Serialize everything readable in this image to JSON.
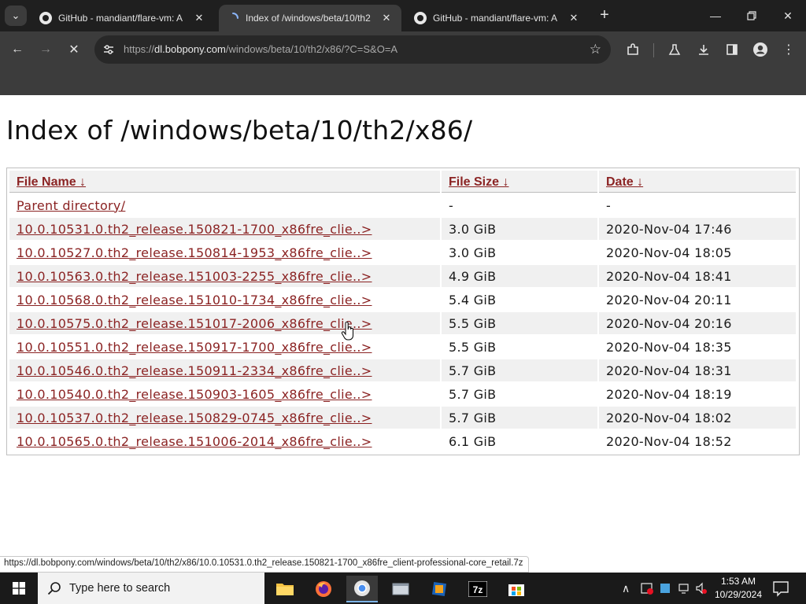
{
  "browser": {
    "tabs": [
      {
        "title": "GitHub - mandiant/flare-vm: A",
        "active": false
      },
      {
        "title": "Index of /windows/beta/10/th2",
        "active": true
      },
      {
        "title": "GitHub - mandiant/flare-vm: A",
        "active": false
      }
    ],
    "url_host": "dl.bobpony.com",
    "url_path": "/windows/beta/10/th2/x86/?C=S&O=A",
    "url_scheme": "https://"
  },
  "page": {
    "title": "Index of /windows/beta/10/th2/x86/",
    "columns": {
      "name": "File Name  ↓",
      "size": "File Size  ↓",
      "date": "Date  ↓"
    },
    "parent": {
      "name": "Parent directory/",
      "size": "-",
      "date": "-"
    },
    "rows": [
      {
        "name": "10.0.10531.0.th2_release.150821-1700_x86fre_clie..>",
        "size": "3.0 GiB",
        "date": "2020-Nov-04 17:46"
      },
      {
        "name": "10.0.10527.0.th2_release.150814-1953_x86fre_clie..>",
        "size": "3.0 GiB",
        "date": "2020-Nov-04 18:05"
      },
      {
        "name": "10.0.10563.0.th2_release.151003-2255_x86fre_clie..>",
        "size": "4.9 GiB",
        "date": "2020-Nov-04 18:41"
      },
      {
        "name": "10.0.10568.0.th2_release.151010-1734_x86fre_clie..>",
        "size": "5.4 GiB",
        "date": "2020-Nov-04 20:11"
      },
      {
        "name": "10.0.10575.0.th2_release.151017-2006_x86fre_clie..>",
        "size": "5.5 GiB",
        "date": "2020-Nov-04 20:16"
      },
      {
        "name": "10.0.10551.0.th2_release.150917-1700_x86fre_clie..>",
        "size": "5.5 GiB",
        "date": "2020-Nov-04 18:35"
      },
      {
        "name": "10.0.10546.0.th2_release.150911-2334_x86fre_clie..>",
        "size": "5.7 GiB",
        "date": "2020-Nov-04 18:31"
      },
      {
        "name": "10.0.10540.0.th2_release.150903-1605_x86fre_clie..>",
        "size": "5.7 GiB",
        "date": "2020-Nov-04 18:19"
      },
      {
        "name": "10.0.10537.0.th2_release.150829-0745_x86fre_clie..>",
        "size": "5.7 GiB",
        "date": "2020-Nov-04 18:02"
      },
      {
        "name": "10.0.10565.0.th2_release.151006-2014_x86fre_clie..>",
        "size": "6.1 GiB",
        "date": "2020-Nov-04 18:52"
      }
    ]
  },
  "status_url": "https://dl.bobpony.com/windows/beta/10/th2/x86/10.0.10531.0.th2_release.150821-1700_x86fre_client-professional-core_retail.7z",
  "taskbar": {
    "search_placeholder": "Type here to search",
    "time": "1:53 AM",
    "date": "10/29/2024"
  },
  "colors": {
    "link": "#8b2323",
    "chrome_dark": "#1f1f1f",
    "chrome_toolbar": "#3c3c3c",
    "taskbar": "#1a1a1a"
  }
}
